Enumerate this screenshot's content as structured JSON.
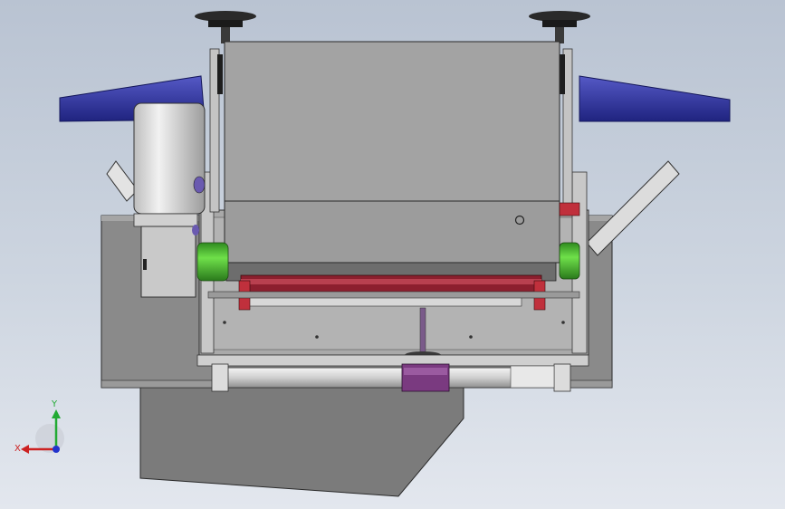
{
  "viewport": {
    "background_top": "#b9c3d2",
    "background_bottom": "#e3e7ee"
  },
  "triad": {
    "x_label": "X",
    "y_label": "Y",
    "x_color": "#cc2222",
    "y_color": "#22aa33",
    "z_color": "#2233cc"
  },
  "colors": {
    "hopper_wing": "#2b2f9a",
    "housing_gray": "#a3a3a3",
    "panel_dark": "#7d7d7d",
    "roller_green": "#4bc830",
    "bracket_red": "#b02030",
    "slider_purple": "#7a3a80",
    "motor_silver": "#d6d6d6"
  }
}
